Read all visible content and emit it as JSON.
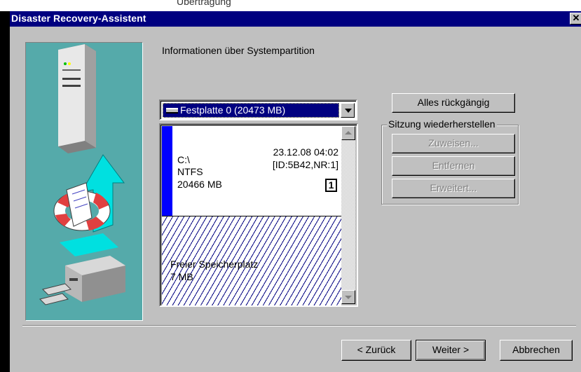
{
  "top_strip": {
    "text": "Übertragung"
  },
  "window": {
    "title": "Disaster Recovery-Assistent",
    "close_glyph": "✕"
  },
  "main": {
    "heading": "Informationen über Systempartition",
    "disk_dropdown": {
      "selected": "Festplatte 0 (20473 MB)"
    },
    "partition": {
      "drive": "C:\\",
      "filesystem": "NTFS",
      "size": "20466 MB",
      "date": "23.12.08 04:02",
      "id": "[ID:5B42,NR:1]",
      "number": "1"
    },
    "free_space": {
      "label": "Freier Speicherplatz",
      "size": "7 MB"
    }
  },
  "right_panel": {
    "undo_all": "Alles rückgängig",
    "group_title": "Sitzung wiederherstellen",
    "assign": "Zuweisen...",
    "remove": "Entfernen",
    "advanced": "Erweitert..."
  },
  "footer": {
    "back": "< Zurück",
    "next": "Weiter >",
    "cancel": "Abbrechen"
  },
  "colors": {
    "titlebar": "#000080",
    "face": "#c0c0c0",
    "illustration_bg": "#55aaaa",
    "partition_bar": "#0000ff"
  }
}
